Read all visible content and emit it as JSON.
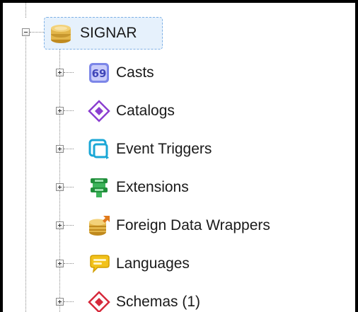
{
  "tree": {
    "root": {
      "label": "SIGNAR",
      "icon": "database-icon",
      "expanded": true
    },
    "children": [
      {
        "label": "Casts",
        "icon": "casts-icon"
      },
      {
        "label": "Catalogs",
        "icon": "catalogs-icon"
      },
      {
        "label": "Event Triggers",
        "icon": "event-triggers-icon"
      },
      {
        "label": "Extensions",
        "icon": "extensions-icon"
      },
      {
        "label": "Foreign Data Wrappers",
        "icon": "foreign-data-wrappers-icon"
      },
      {
        "label": "Languages",
        "icon": "languages-icon"
      },
      {
        "label": "Schemas (1)",
        "icon": "schemas-icon"
      }
    ]
  },
  "colors": {
    "selection_bg": "#e6f1fc",
    "selection_border": "#7fb1e6",
    "database": "#e3b64a",
    "casts": "#7c86e8",
    "catalogs": "#8b3fd0",
    "event_triggers": "#1aa7d6",
    "extensions": "#1f8f3a",
    "languages": "#f2c21b",
    "schemas": "#d6293b"
  }
}
